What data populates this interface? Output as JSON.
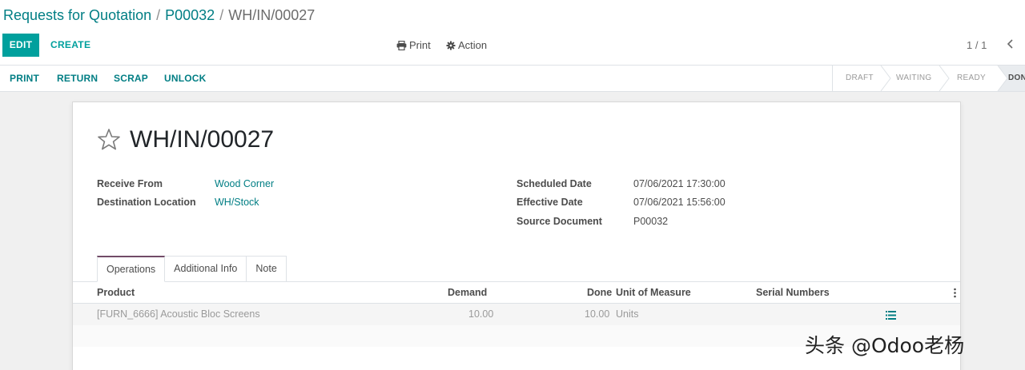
{
  "breadcrumb": {
    "items": [
      "Requests for Quotation",
      "P00032"
    ],
    "current": "WH/IN/00027",
    "separator": "/"
  },
  "toolbar": {
    "edit_label": "EDIT",
    "create_label": "CREATE",
    "print_label": "Print",
    "action_label": "Action",
    "pager_value": "1 / 1",
    "pager_prev_glyph": "‹"
  },
  "statusbar": {
    "buttons": [
      "PRINT",
      "RETURN",
      "SCRAP",
      "UNLOCK"
    ],
    "steps": [
      "DRAFT",
      "WAITING",
      "READY",
      "DONE"
    ],
    "active_step": "DONE"
  },
  "record": {
    "title": "WH/IN/00027",
    "fields_left": [
      {
        "label": "Receive From",
        "value": "Wood Corner"
      },
      {
        "label": "Destination Location",
        "value": "WH/Stock"
      }
    ],
    "fields_right": [
      {
        "label": "Scheduled Date",
        "value": "07/06/2021 17:30:00"
      },
      {
        "label": "Effective Date",
        "value": "07/06/2021 15:56:00"
      },
      {
        "label": "Source Document",
        "value": "P00032"
      }
    ]
  },
  "tabs": [
    {
      "label": "Operations",
      "active": true
    },
    {
      "label": "Additional Info",
      "active": false
    },
    {
      "label": "Note",
      "active": false
    }
  ],
  "table": {
    "headers": {
      "product": "Product",
      "demand": "Demand",
      "done": "Done",
      "uom": "Unit of Measure",
      "serial": "Serial Numbers"
    },
    "rows": [
      {
        "product": "[FURN_6666] Acoustic Bloc Screens",
        "demand": "10.00",
        "done": "10.00",
        "uom": "Units"
      }
    ]
  },
  "watermark": "头条 @Odoo老杨",
  "colors": {
    "primary": "#00a09d",
    "link": "#017e84",
    "tab_accent": "#714b67"
  }
}
